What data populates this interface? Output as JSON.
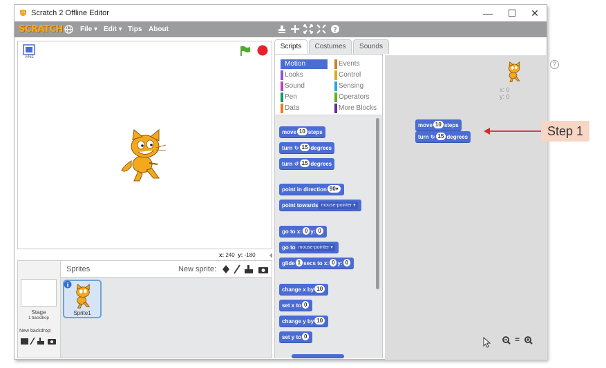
{
  "window": {
    "title": "Scratch 2 Offline Editor",
    "controls": [
      "—",
      "☐",
      "✕"
    ]
  },
  "menubar": {
    "logo": "SCRATCH",
    "items": [
      "File ▾",
      "Edit ▾",
      "Tips",
      "About"
    ]
  },
  "stage": {
    "version": "v461",
    "coords_x_label": "x:",
    "coords_x": "240",
    "coords_y_label": "y:",
    "coords_y": "-180"
  },
  "sprites": {
    "header": "Sprites",
    "new_sprite_label": "New sprite:",
    "stage_label": "Stage",
    "stage_backdrops": "1 backdrop",
    "new_backdrop_label": "New backdrop:",
    "sprite1_name": "Sprite1"
  },
  "tabs": [
    "Scripts",
    "Costumes",
    "Sounds"
  ],
  "categories": [
    {
      "name": "Motion",
      "color": "#4a6cd4"
    },
    {
      "name": "Events",
      "color": "#c88330"
    },
    {
      "name": "Looks",
      "color": "#8a55d7"
    },
    {
      "name": "Control",
      "color": "#e1a91a"
    },
    {
      "name": "Sound",
      "color": "#bb42c3"
    },
    {
      "name": "Sensing",
      "color": "#2ca5e2"
    },
    {
      "name": "Pen",
      "color": "#0e9a6c"
    },
    {
      "name": "Operators",
      "color": "#5cb712"
    },
    {
      "name": "Data",
      "color": "#ee7d16"
    },
    {
      "name": "More Blocks",
      "color": "#632d99"
    }
  ],
  "blocks": {
    "move": "move",
    "move_val": "10",
    "steps": "steps",
    "turn": "turn",
    "turn_cw_val": "15",
    "turn_ccw_val": "15",
    "degrees": "degrees",
    "point_dir": "point in direction",
    "point_dir_val": "90▾",
    "point_towards": "point towards",
    "mouse_pointer": "mouse-pointer ▾",
    "goto_xy": "go to x:",
    "goto_x": "0",
    "y_label": "y:",
    "goto_y": "0",
    "goto": "go to",
    "goto_target": "mouse-pointer ▾",
    "glide": "glide",
    "glide_secs": "1",
    "secs_to_x": "secs to x:",
    "glide_x": "0",
    "glide_y": "0",
    "change_x": "change x by",
    "change_x_val": "10",
    "set_x": "set x to",
    "set_x_val": "0",
    "change_y": "change y by",
    "change_y_val": "10",
    "set_y": "set y to",
    "set_y_val": "0"
  },
  "script": {
    "move_label": "move",
    "move_val": "10",
    "steps": "steps",
    "turn_label": "turn",
    "turn_val": "15",
    "degrees": "degrees",
    "sprite_x": "x: 0",
    "sprite_y": "y: 0"
  },
  "zoom": [
    "🔍",
    "=",
    "🔍"
  ],
  "annotation": {
    "label": "Step 1",
    "color": "#d9272e"
  }
}
